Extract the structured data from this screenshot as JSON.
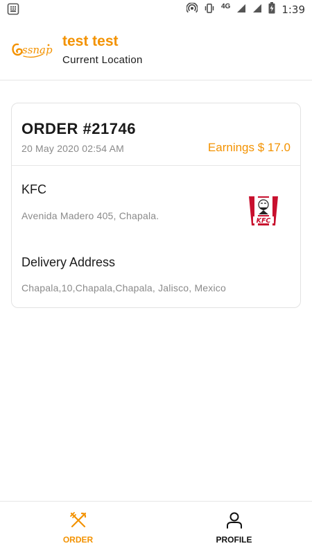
{
  "status_bar": {
    "time": "1:39",
    "network": "4G",
    "icons": [
      "notification-icon",
      "hotspot-icon",
      "vibrate-icon",
      "signal-icon",
      "signal-icon",
      "battery-charging-icon"
    ]
  },
  "header": {
    "logo_text": "Essnap",
    "user_name": "test test",
    "location_label": "Current Location"
  },
  "order": {
    "number": "ORDER #21746",
    "date": "20 May 2020 02:54 AM",
    "earnings": "Earnings $ 17.0",
    "restaurant": {
      "name": "KFC",
      "address": "Avenida Madero 405, Chapala.",
      "logo_text": "KFC"
    },
    "delivery": {
      "title": "Delivery Address",
      "address": "Chapala,10,Chapala,Chapala, Jalisco, Mexico"
    }
  },
  "nav": {
    "items": [
      {
        "label": "ORDER",
        "icon": "fork-knife-icon",
        "active": true
      },
      {
        "label": "PROFILE",
        "icon": "person-icon",
        "active": false
      }
    ]
  },
  "colors": {
    "accent": "#f39200",
    "text": "#1a1a1a",
    "muted": "#8a8a8a",
    "divider": "#e6e6e6",
    "kfc_red": "#c8102e"
  }
}
